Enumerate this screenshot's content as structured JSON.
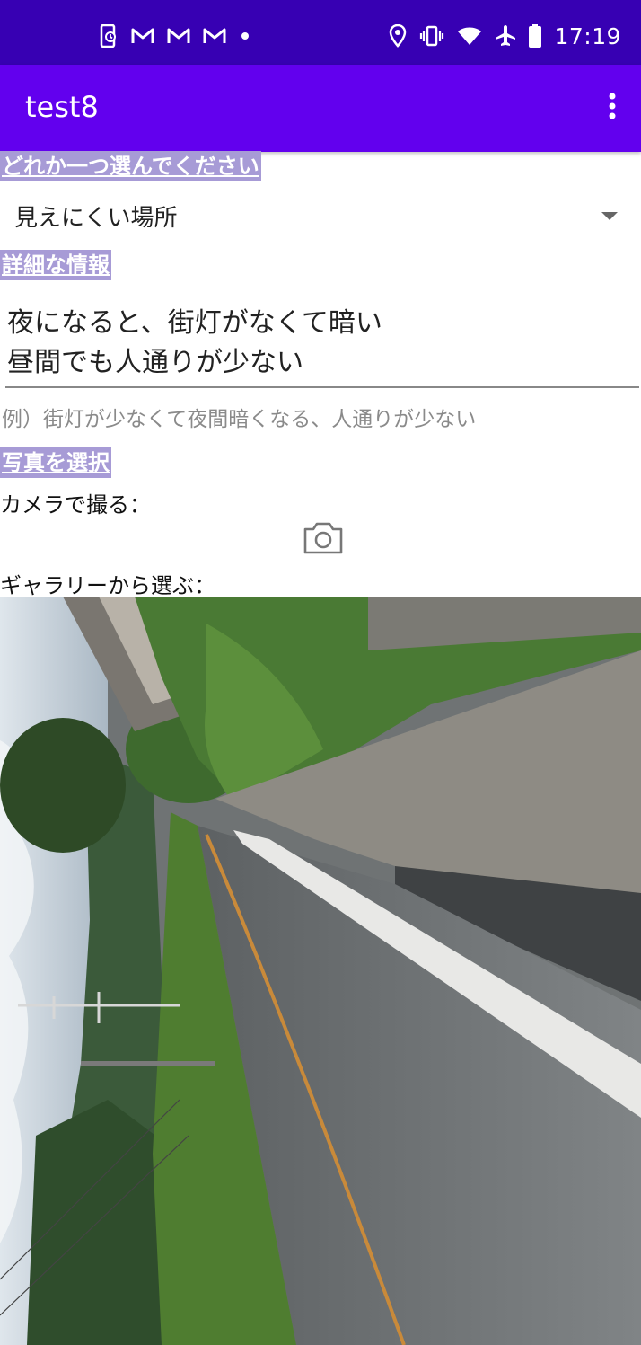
{
  "status_bar": {
    "time": "17:19",
    "left_icons": [
      "phone-screen-icon",
      "gmail-icon",
      "gmail-icon",
      "gmail-icon",
      "dot-icon"
    ],
    "right_icons": [
      "location-icon",
      "vibrate-icon",
      "wifi-icon",
      "airplane-icon",
      "battery-icon"
    ],
    "background": "#3700b3"
  },
  "app_bar": {
    "title": "test8",
    "menu_icon": "more-vert-icon",
    "background": "#6200ee"
  },
  "form": {
    "select_label": "どれか一つ選んでください",
    "selected_option": "見えにくい場所",
    "details_label": "詳細な情報",
    "details_lines": [
      "夜になると、街灯がなくて暗い",
      "昼間でも人通りが少ない"
    ],
    "details_hint": "例）街灯が少なくて夜間暗くなる、人通りが少ない",
    "photo_label": "写真を選択",
    "camera_label": "カメラで撮る：",
    "camera_icon": "camera-icon",
    "gallery_label": "ギャラリーから選ぶ：",
    "label_highlight": "#a79bd6"
  }
}
